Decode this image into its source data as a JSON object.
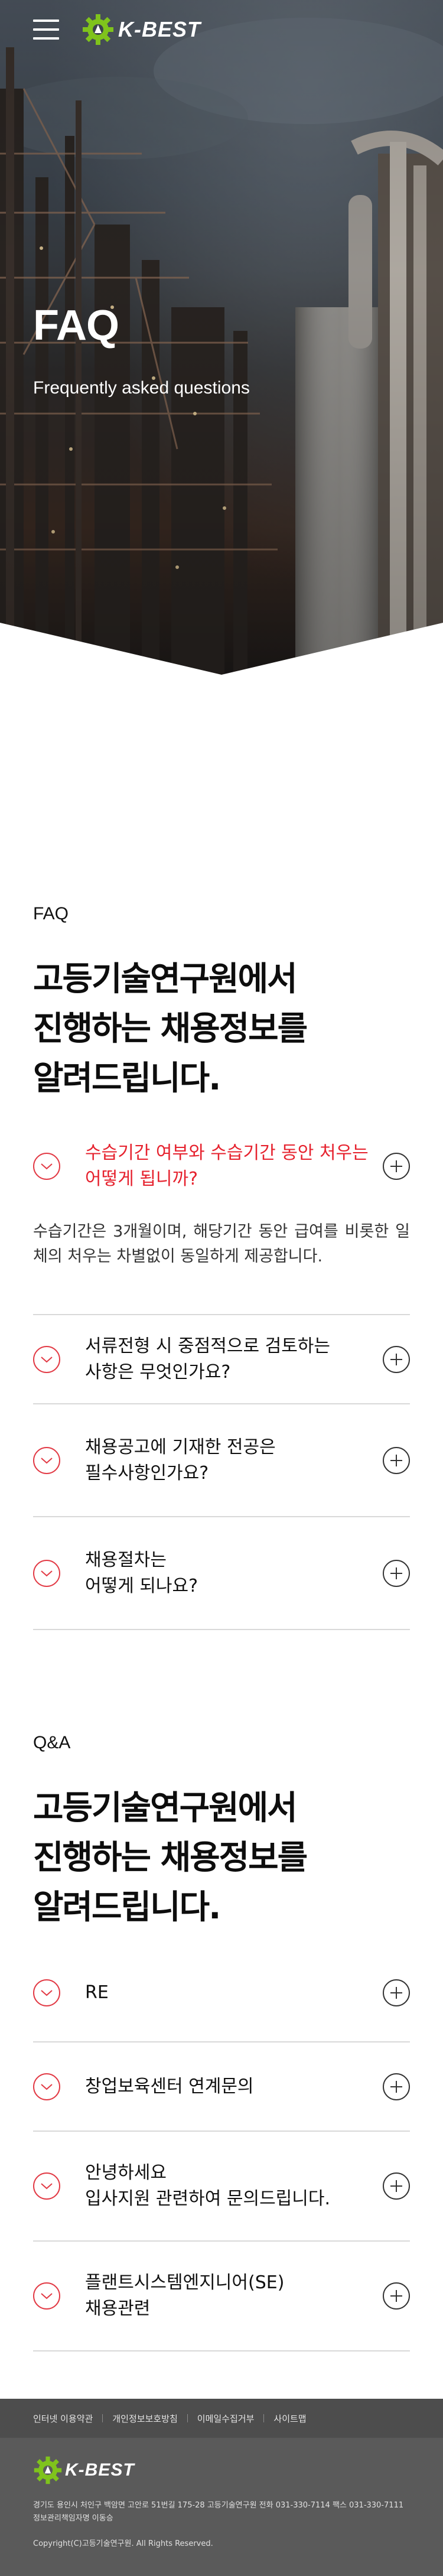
{
  "brand": {
    "logo_text": "K-BEST",
    "accent": "#7fc31c",
    "red": "#e6222e"
  },
  "header": {
    "menu_icon": "hamburger-menu-icon"
  },
  "hero": {
    "title": "FAQ",
    "subtitle": "Frequently asked questions"
  },
  "faq": {
    "eyebrow": "FAQ",
    "headline": [
      "고등기술연구원에서",
      "진행하는 채용정보를",
      "알려드립니다."
    ],
    "items": [
      {
        "question": [
          "수습기간 여부와 수습기간 동안 처우는",
          "어떻게 됩니까?"
        ],
        "open": true,
        "answer": "수습기간은 3개월이며, 해당기간 동안 급여를 비롯한 일체의 처우는 차별없이 동일하게 제공합니다."
      },
      {
        "question": [
          "서류전형 시 중점적으로 검토하는",
          "사항은 무엇인가요?"
        ],
        "open": false
      },
      {
        "question": [
          "채용공고에 기재한 전공은",
          "필수사항인가요?"
        ],
        "open": false
      },
      {
        "question": [
          "채용절차는",
          "어떻게 되나요?"
        ],
        "open": false
      }
    ]
  },
  "qa": {
    "eyebrow": "Q&A",
    "headline": [
      "고등기술연구원에서",
      "진행하는 채용정보를",
      "알려드립니다."
    ],
    "items": [
      {
        "question": [
          "RE"
        ]
      },
      {
        "question": [
          "창업보육센터 연계문의"
        ]
      },
      {
        "question": [
          "안녕하세요",
          "입사지원 관련하여 문의드립니다."
        ]
      },
      {
        "question": [
          "플랜트시스템엔지니어(SE)",
          "채용관련"
        ]
      }
    ]
  },
  "footer": {
    "links": [
      "인터넷 이용약관",
      "개인정보보호방침",
      "이메일수집거부",
      "사이트맵"
    ],
    "logo_text": "K-BEST",
    "address_line1": "경기도 용인시 처인구 백암면 고안로 51번길 175-28 고등기술연구원 전화 031-330-7114 팩스 031-330-7111",
    "address_line2": "정보관리책임자명 이동승",
    "copyright": "Copyright(C)고등기술연구원. All Rights Reserved."
  }
}
